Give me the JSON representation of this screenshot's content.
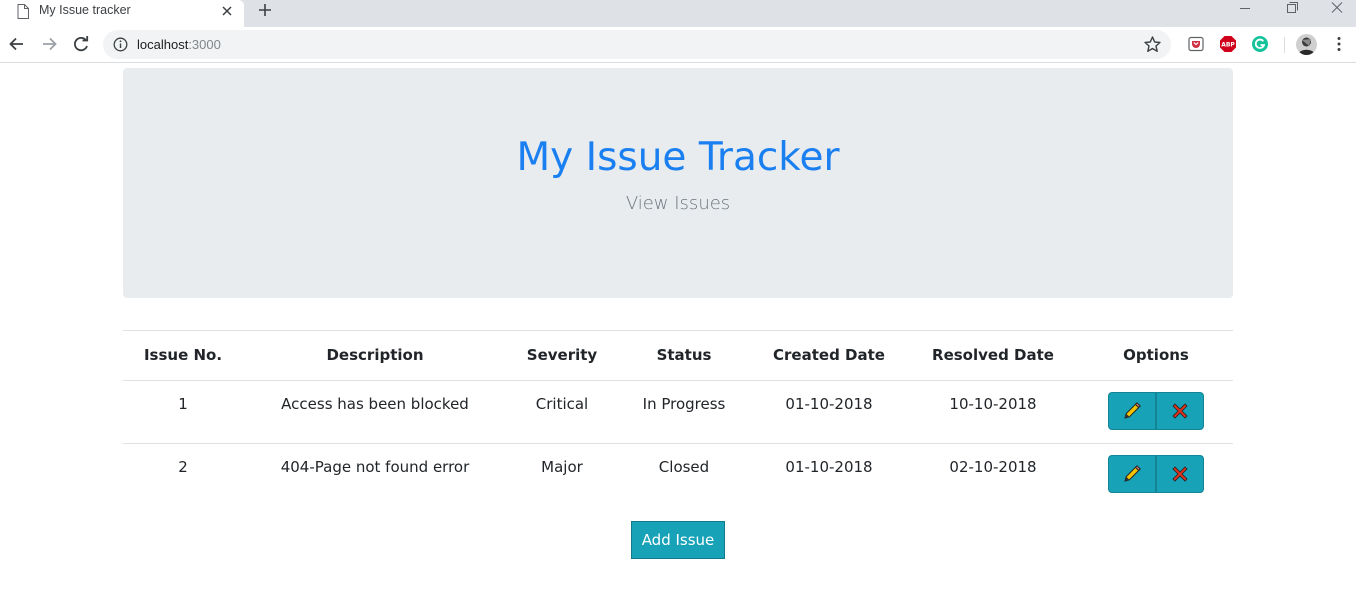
{
  "browser": {
    "tab_title": "My Issue tracker",
    "url_host": "localhost",
    "url_port": ":3000"
  },
  "jumbotron": {
    "title": "My Issue Tracker",
    "subtitle": "View Issues"
  },
  "table": {
    "headers": {
      "issue_no": "Issue No.",
      "description": "Description",
      "severity": "Severity",
      "status": "Status",
      "created_date": "Created Date",
      "resolved_date": "Resolved Date",
      "options": "Options"
    },
    "rows": [
      {
        "issue_no": "1",
        "description": "Access has been blocked",
        "severity": "Critical",
        "status": "In Progress",
        "created_date": "01-10-2018",
        "resolved_date": "10-10-2018"
      },
      {
        "issue_no": "2",
        "description": "404-Page not found error",
        "severity": "Major",
        "status": "Closed",
        "created_date": "01-10-2018",
        "resolved_date": "02-10-2018"
      }
    ]
  },
  "actions": {
    "add_issue": "Add Issue"
  },
  "colors": {
    "accent": "#1a7ff0",
    "button": "#17a2b8",
    "jumbotron_bg": "#e9ecef"
  },
  "icons": {
    "edit": "pencil-icon",
    "delete": "cross-icon"
  }
}
